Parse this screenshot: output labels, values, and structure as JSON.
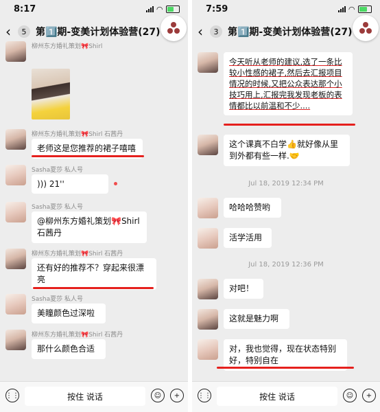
{
  "left": {
    "time": "8:17",
    "count": "5",
    "title": "第1️⃣期-变美计划体验营(27)",
    "messages": {
      "m1_sender": "柳州东方婚礼策划🎀Shirl",
      "m2_sender": "柳州东方婚礼策划🎀Shirl 石茜丹",
      "m2_text": "老师这是您推荐的裙子嘻嘻",
      "m3_sender": "Sasha夏莎 私人号",
      "m3_voice": "21''",
      "m4_sender": "Sasha夏莎 私人号",
      "m4_text": "@柳州东方婚礼策划🎀Shirl 石茜丹",
      "m5_sender": "柳州东方婚礼策划🎀Shirl 石茜丹",
      "m5_text": "还有好的推荐不？穿起来很漂亮",
      "m6_sender": "Sasha夏莎 私人号",
      "m6_text": "美瞳颜色过深啦",
      "m7_sender": "柳州东方婚礼策划🎀Shirl 石茜丹",
      "m7_text": "那什么颜色合适"
    },
    "input_label": "按住 说话"
  },
  "right": {
    "time": "7:59",
    "count": "3",
    "title": "第1️⃣期-变美计划体验营(27)",
    "messages": {
      "m1_text": "今天听从老师的建议,选了一条比较小性感的裙子,然后去汇报项目情况的时候,又把公众表达那个小技巧用上,汇报完我发现老板的表情都比以前温和不少....",
      "m2_text": "这个课真不白学👍就好像从里到外都有些一样.🤝",
      "t1": "Jul 18, 2019 12:34 PM",
      "m3_text": "哈哈哈赞哟",
      "m4_text": "活学活用",
      "t2": "Jul 18, 2019 12:36 PM",
      "m5_text": "对吧！",
      "m6_text": "这就是魅力啊",
      "m7_text": "对，我也觉得，现在状态特别好，特别自在"
    },
    "input_label": "按住 说话"
  },
  "icons": [
    "back-chevron-icon",
    "voice-icon",
    "emoji-icon",
    "plus-icon",
    "keyboard-icon",
    "signal-icon",
    "wifi-icon",
    "battery-icon",
    "group-menu-icon"
  ],
  "colors": {
    "highlight_line": "#e5201d",
    "chat_bg": "#ededed",
    "bubble": "#ffffff"
  }
}
